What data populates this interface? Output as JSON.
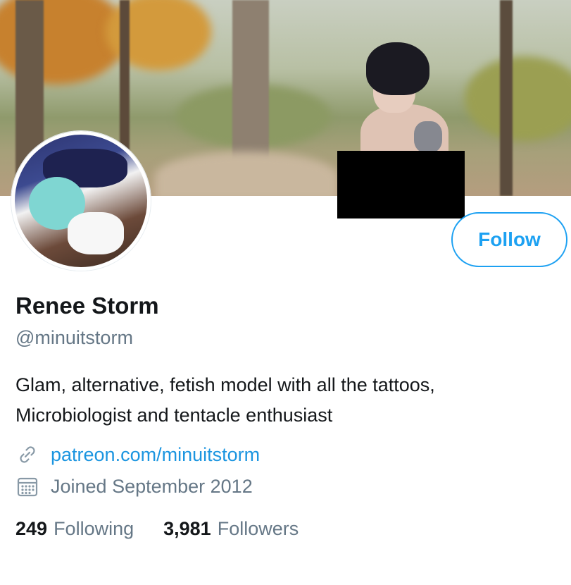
{
  "profile": {
    "name": "Renee Storm",
    "handle": "@minuitstorm",
    "bio_line_1": "Glam, alternative, fetish model with all the tattoos,",
    "bio_line_2": "Microbiologist and tentacle enthusiast",
    "website": "patreon.com/minuitstorm",
    "joined": "Joined September 2012",
    "follow_label": "Follow"
  },
  "stats": {
    "following_count": "249",
    "following_label": "Following",
    "followers_count": "3,981",
    "followers_label": "Followers"
  },
  "icons": {
    "link": "link-icon",
    "calendar": "calendar-icon"
  },
  "colors": {
    "accent": "#1da1f2",
    "link": "#1b95e0",
    "muted": "#657786",
    "text": "#14171a"
  }
}
